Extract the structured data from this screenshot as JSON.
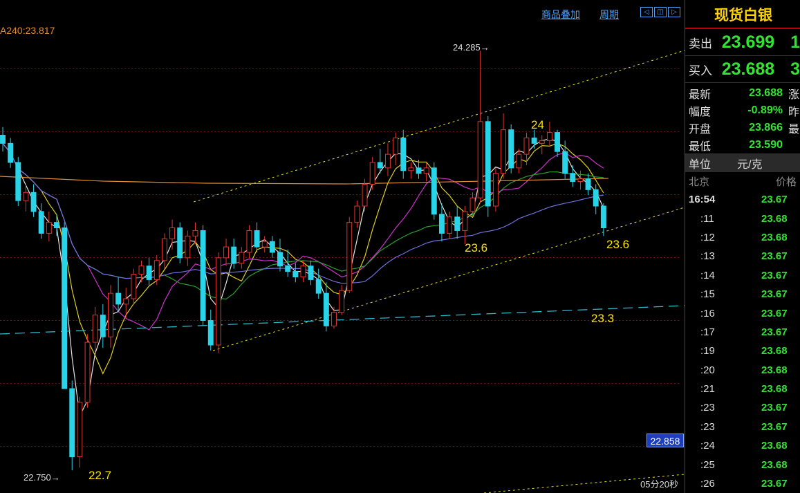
{
  "toolbar": {
    "overlay_label": "商品叠加",
    "period_label": "周期",
    "nav_buttons": [
      "◁",
      "◫",
      "▷"
    ]
  },
  "indicator": {
    "ma240_label": "A240:23.817"
  },
  "chart_data": {
    "type": "candlestick",
    "ylim": [
      22.7,
      24.4
    ],
    "grid_levels": [
      24.224,
      23.993,
      23.762,
      23.531,
      23.3,
      23.069,
      22.838
    ],
    "candles": [
      [
        23.98,
        24.01,
        23.92,
        23.95
      ],
      [
        23.95,
        23.97,
        23.86,
        23.88
      ],
      [
        23.88,
        23.9,
        23.72,
        23.74
      ],
      [
        23.74,
        23.8,
        23.7,
        23.77
      ],
      [
        23.77,
        23.8,
        23.68,
        23.7
      ],
      [
        23.7,
        23.73,
        23.6,
        23.62
      ],
      [
        23.62,
        23.7,
        23.59,
        23.66
      ],
      [
        23.66,
        23.69,
        23.61,
        23.64
      ],
      [
        23.64,
        23.66,
        23.05,
        23.05
      ],
      [
        23.05,
        23.08,
        22.75,
        22.8
      ],
      [
        22.8,
        23.02,
        22.76,
        23.0
      ],
      [
        23.0,
        23.25,
        22.98,
        23.22
      ],
      [
        23.22,
        23.35,
        23.18,
        23.32
      ],
      [
        23.32,
        23.36,
        23.2,
        23.24
      ],
      [
        23.24,
        23.43,
        23.2,
        23.4
      ],
      [
        23.4,
        23.46,
        23.33,
        23.36
      ],
      [
        23.36,
        23.42,
        23.31,
        23.38
      ],
      [
        23.38,
        23.49,
        23.36,
        23.47
      ],
      [
        23.47,
        23.52,
        23.44,
        23.5
      ],
      [
        23.5,
        23.53,
        23.43,
        23.45
      ],
      [
        23.45,
        23.54,
        23.43,
        23.52
      ],
      [
        23.52,
        23.62,
        23.49,
        23.6
      ],
      [
        23.6,
        23.67,
        23.56,
        23.64
      ],
      [
        23.64,
        23.66,
        23.51,
        23.53
      ],
      [
        23.53,
        23.63,
        23.5,
        23.61
      ],
      [
        23.61,
        23.66,
        23.58,
        23.63
      ],
      [
        23.63,
        23.65,
        23.28,
        23.3
      ],
      [
        23.3,
        23.34,
        23.19,
        23.21
      ],
      [
        23.21,
        23.55,
        23.18,
        23.53
      ],
      [
        23.53,
        23.6,
        23.5,
        23.57
      ],
      [
        23.57,
        23.6,
        23.49,
        23.51
      ],
      [
        23.51,
        23.57,
        23.49,
        23.55
      ],
      [
        23.55,
        23.65,
        23.53,
        23.63
      ],
      [
        23.63,
        23.66,
        23.55,
        23.57
      ],
      [
        23.57,
        23.61,
        23.55,
        23.59
      ],
      [
        23.59,
        23.61,
        23.53,
        23.55
      ],
      [
        23.55,
        23.6,
        23.48,
        23.5
      ],
      [
        23.5,
        23.56,
        23.46,
        23.48
      ],
      [
        23.48,
        23.51,
        23.44,
        23.46
      ],
      [
        23.46,
        23.52,
        23.44,
        23.5
      ],
      [
        23.5,
        23.52,
        23.43,
        23.45
      ],
      [
        23.45,
        23.49,
        23.38,
        23.4
      ],
      [
        23.4,
        23.44,
        23.26,
        23.28
      ],
      [
        23.28,
        23.35,
        23.27,
        23.33
      ],
      [
        23.33,
        23.43,
        23.32,
        23.41
      ],
      [
        23.41,
        23.68,
        23.4,
        23.66
      ],
      [
        23.66,
        23.74,
        23.64,
        23.72
      ],
      [
        23.72,
        23.82,
        23.7,
        23.8
      ],
      [
        23.8,
        23.9,
        23.78,
        23.88
      ],
      [
        23.88,
        23.93,
        23.84,
        23.86
      ],
      [
        23.86,
        23.95,
        23.83,
        23.91
      ],
      [
        23.91,
        23.99,
        23.87,
        23.97
      ],
      [
        23.97,
        24.0,
        23.82,
        23.85
      ],
      [
        23.85,
        23.88,
        23.82,
        23.86
      ],
      [
        23.86,
        23.89,
        23.82,
        23.84
      ],
      [
        23.84,
        23.88,
        23.81,
        23.86
      ],
      [
        23.86,
        23.88,
        23.67,
        23.69
      ],
      [
        23.69,
        23.73,
        23.59,
        23.62
      ],
      [
        23.62,
        23.7,
        23.6,
        23.68
      ],
      [
        23.68,
        23.72,
        23.6,
        23.63
      ],
      [
        23.63,
        23.72,
        23.58,
        23.7
      ],
      [
        23.7,
        23.77,
        23.68,
        23.75
      ],
      [
        23.75,
        24.29,
        23.73,
        24.03
      ],
      [
        24.03,
        24.05,
        23.68,
        23.72
      ],
      [
        23.72,
        23.86,
        23.7,
        23.84
      ],
      [
        23.84,
        24.06,
        23.82,
        24.0
      ],
      [
        24.0,
        24.02,
        23.84,
        23.86
      ],
      [
        23.86,
        23.93,
        23.84,
        23.91
      ],
      [
        23.91,
        23.99,
        23.87,
        23.97
      ],
      [
        23.97,
        24.0,
        23.93,
        23.95
      ],
      [
        23.95,
        23.98,
        23.91,
        23.96
      ],
      [
        23.96,
        24.03,
        23.94,
        23.99
      ],
      [
        23.99,
        24.0,
        23.9,
        23.92
      ],
      [
        23.92,
        23.96,
        23.82,
        23.84
      ],
      [
        23.84,
        23.87,
        23.79,
        23.81
      ],
      [
        23.81,
        23.85,
        23.78,
        23.82
      ],
      [
        23.82,
        23.84,
        23.76,
        23.78
      ],
      [
        23.78,
        23.8,
        23.69,
        23.72
      ],
      [
        23.72,
        23.73,
        23.61,
        23.64
      ]
    ]
  },
  "annotations": {
    "high_marker": "24.285",
    "low_marker": "22.750",
    "label_24": "24",
    "label_23_6_a": "23.6",
    "label_23_6_b": "23.6",
    "label_23_3": "23.3",
    "label_22_7": "22.7",
    "current_price": "22.858",
    "period": "05分20秒"
  },
  "colors": {
    "up": "#e5332f",
    "down": "#2ad4e8",
    "grid": "#7a1010",
    "channel": "#e8e02a",
    "support": "#2ab8c8"
  },
  "panel": {
    "title": "现货白银",
    "sell_label": "卖出",
    "sell_value": "23.699",
    "sell_extra": "1",
    "buy_label": "买入",
    "buy_value": "23.688",
    "buy_extra": "3",
    "info": [
      {
        "k": "最新",
        "v": "23.688",
        "x": "涨"
      },
      {
        "k": "幅度",
        "v": "-0.89%",
        "x": "昨"
      },
      {
        "k": "开盘",
        "v": "23.866",
        "x": "最"
      },
      {
        "k": "最低",
        "v": "23.590",
        "x": ""
      }
    ],
    "unit_label": "单位",
    "unit_value": "元/克",
    "ticks_head_left": "北京",
    "ticks_head_right": "价格",
    "ticks": [
      {
        "t": "16:54",
        "p": "23.67"
      },
      {
        "t": ":11",
        "p": "23.68"
      },
      {
        "t": ":12",
        "p": "23.68"
      },
      {
        "t": ":13",
        "p": "23.67"
      },
      {
        "t": ":14",
        "p": "23.67"
      },
      {
        "t": ":15",
        "p": "23.67"
      },
      {
        "t": ":16",
        "p": "23.67"
      },
      {
        "t": ":17",
        "p": "23.67"
      },
      {
        "t": ":19",
        "p": "23.68"
      },
      {
        "t": ":20",
        "p": "23.68"
      },
      {
        "t": ":21",
        "p": "23.68"
      },
      {
        "t": ":23",
        "p": "23.67"
      },
      {
        "t": ":23",
        "p": "23.67"
      },
      {
        "t": ":24",
        "p": "23.68"
      },
      {
        "t": ":25",
        "p": "23.68"
      },
      {
        "t": ":26",
        "p": "23.67"
      }
    ]
  }
}
